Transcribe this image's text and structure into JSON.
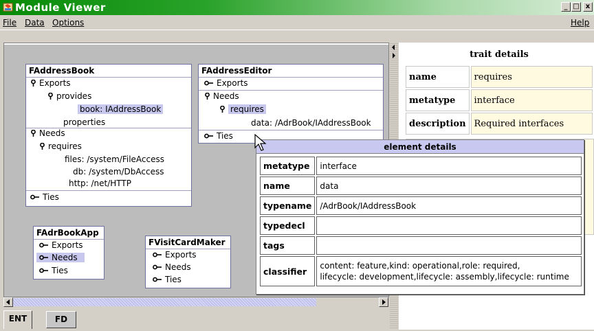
{
  "window": {
    "title": "Module Viewer",
    "minimize": "_",
    "maximize": "□",
    "close": "x"
  },
  "menu": {
    "file": "File",
    "data": "Data",
    "options": "Options",
    "help": "Help"
  },
  "modules": {
    "address_book": {
      "title": "FAddressBook",
      "exports": "Exports",
      "provides": "provides",
      "book": "book: IAddressBook",
      "properties": "properties",
      "needs": "Needs",
      "requires": "requires",
      "files": "files: /system/FileAccess",
      "db": "db: /system/DbAccess",
      "http": "http: /net/HTTP",
      "ties": "Ties"
    },
    "address_editor": {
      "title": "FAddressEditor",
      "exports": "Exports",
      "needs": "Needs",
      "requires": "requires",
      "data": "data: /AdrBook/IAddressBook",
      "ties": "Ties"
    },
    "adrbook_app": {
      "title": "FAdrBookApp",
      "exports": "Exports",
      "needs": "Needs",
      "ties": "Ties"
    },
    "visitcard_maker": {
      "title": "FVisitCardMaker",
      "exports": "Exports",
      "needs": "Needs",
      "ties": "Ties"
    }
  },
  "trait_details": {
    "title": "trait details",
    "rows": [
      {
        "key": "name",
        "value": "requires"
      },
      {
        "key": "metatype",
        "value": "interface"
      },
      {
        "key": "description",
        "value": "Required interfaces"
      }
    ]
  },
  "element_details": {
    "title": "element details",
    "rows": [
      {
        "key": "metatype",
        "value": "interface"
      },
      {
        "key": "name",
        "value": "data"
      },
      {
        "key": "typename",
        "value": "/AdrBook/IAddressBook"
      },
      {
        "key": "typedecl",
        "value": ""
      },
      {
        "key": "tags",
        "value": ""
      }
    ],
    "classifier_key": "classifier",
    "classifier_line1": "content: feature,kind: operational,role: required,",
    "classifier_line2": "lifecycle: development,lifecycle: assembly,lifecycle: runtime"
  },
  "tabs": {
    "ent": "ENT",
    "fd": "FD"
  },
  "colors": {
    "titlebar": "#088a08",
    "selection": "#c8c8ee",
    "trait_value_bg": "#fffae0",
    "popup_title_bg": "#c8c8f0"
  },
  "icons": [
    "app-icon",
    "pin-icon",
    "key-icon",
    "pointer-cursor-icon",
    "arrow-left-icon",
    "arrow-right-icon"
  ]
}
